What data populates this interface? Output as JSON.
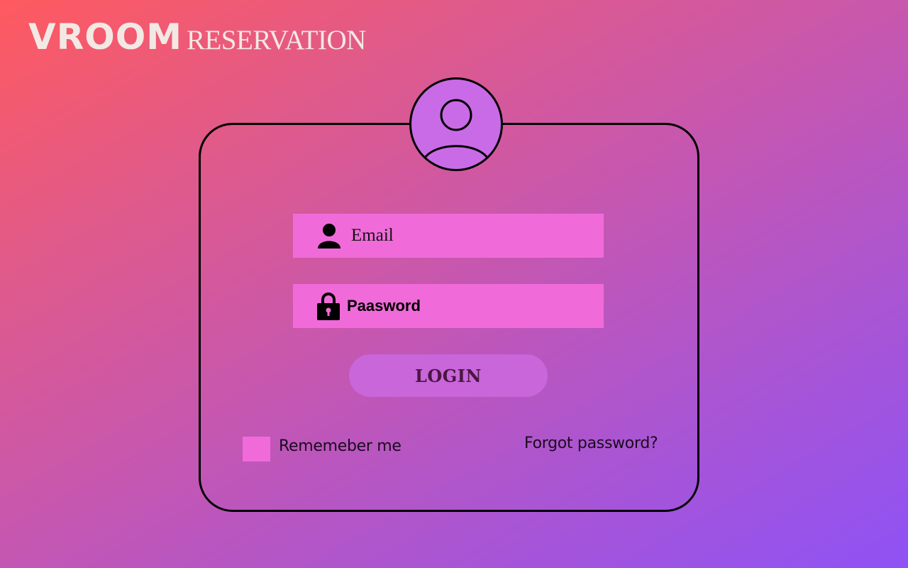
{
  "brand": {
    "name": "VROOM",
    "subtitle": "RESERVATION"
  },
  "login_form": {
    "avatar_icon": "user-circle-icon",
    "email": {
      "placeholder": "Email",
      "icon": "user-icon"
    },
    "password": {
      "placeholder": "Paasword",
      "icon": "lock-icon"
    },
    "submit_label": "LOGIN",
    "remember_label": "Rememeber me",
    "forgot_label": "Forgot password?"
  },
  "colors": {
    "gradient_start": "#ff5a5f",
    "gradient_end": "#8f52f5",
    "field_bg": "#f06bd9",
    "button_bg": "#c866da",
    "avatar_bg": "#c96be6"
  }
}
